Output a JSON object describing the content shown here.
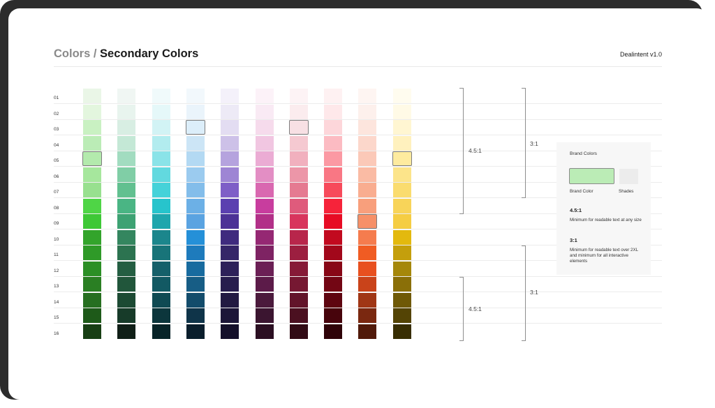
{
  "header": {
    "breadcrumb_parent": "Colors",
    "breadcrumb_separator": " / ",
    "page_title": "Secondary Colors",
    "version": "Dealintent v1.0"
  },
  "rows": [
    "01",
    "02",
    "03",
    "04",
    "05",
    "06",
    "07",
    "08",
    "09",
    "10",
    "11",
    "12",
    "13",
    "14",
    "15",
    "16"
  ],
  "palette": [
    {
      "selected": 4,
      "shades": [
        "#eaf6e7",
        "#e3f6de",
        "#c9f1c2",
        "#bbecb6",
        "#b3eaad",
        "#a6e79d",
        "#98e08f",
        "#4fd546",
        "#3ec836",
        "#33a42b",
        "#2f9a28",
        "#2b8f25",
        "#2a7f23",
        "#266f20",
        "#1e5a19",
        "#183f14"
      ]
    },
    {
      "selected": -1,
      "shades": [
        "#f0f6f3",
        "#e8f4ee",
        "#d8eee3",
        "#c4e8d6",
        "#a2dcc0",
        "#80cea6",
        "#62c090",
        "#4ab584",
        "#3da273",
        "#34865f",
        "#2c7350",
        "#245e42",
        "#21563b",
        "#1c4a33",
        "#173b29",
        "#101f17"
      ]
    },
    {
      "selected": -1,
      "shades": [
        "#f0fafb",
        "#e5f8f9",
        "#d2f3f5",
        "#b2ecef",
        "#8ae3e8",
        "#62d9df",
        "#45d2d9",
        "#27c4cc",
        "#1fa6ad",
        "#1b868c",
        "#187479",
        "#15606a",
        "#125963",
        "#0f4a53",
        "#0c363c",
        "#082428"
      ]
    },
    {
      "selected": 2,
      "shades": [
        "#f2f8fc",
        "#eaf4fb",
        "#dceefa",
        "#cce5f6",
        "#b3d9f3",
        "#9bcbef",
        "#83bdea",
        "#6cb0e6",
        "#5aa3e1",
        "#2590d8",
        "#1e7bbc",
        "#186b9f",
        "#175d85",
        "#134c6b",
        "#0f3449",
        "#0a1e2c"
      ]
    },
    {
      "selected": -1,
      "shades": [
        "#f4f1fa",
        "#edeaf6",
        "#e3ddf2",
        "#cdc1e8",
        "#b5a3de",
        "#9e85d4",
        "#7e5ec7",
        "#5b40b0",
        "#4c3296",
        "#3f2b7e",
        "#352668",
        "#2d2159",
        "#271d4d",
        "#221a42",
        "#1c1638",
        "#14102a"
      ]
    },
    {
      "selected": -1,
      "shades": [
        "#fcf2f8",
        "#f9eaf4",
        "#f6dbec",
        "#f1c6e1",
        "#ebacd4",
        "#e38ec4",
        "#d968b0",
        "#c83d9e",
        "#b23088",
        "#952873",
        "#7e2363",
        "#6b1f55",
        "#5c1b49",
        "#4b1a3c",
        "#3b1530",
        "#2b0f22"
      ]
    },
    {
      "selected": 2,
      "shades": [
        "#fdf3f5",
        "#fbecee",
        "#f8e0e4",
        "#f5c9d1",
        "#f1b0be",
        "#ec96a8",
        "#e57a91",
        "#df5b7c",
        "#d8355d",
        "#b8264b",
        "#9c1f40",
        "#861a37",
        "#761832",
        "#62142a",
        "#4b1020",
        "#320b15"
      ]
    },
    {
      "selected": -1,
      "shades": [
        "#fef1f2",
        "#fee8ea",
        "#fdd6da",
        "#fcbbc2",
        "#fb99a3",
        "#f97784",
        "#f74a5b",
        "#f6233a",
        "#e70b24",
        "#c20a1f",
        "#a2081b",
        "#880716",
        "#730614",
        "#5e0510",
        "#47040c",
        "#2f0308"
      ]
    },
    {
      "selected": 8,
      "shades": [
        "#fef5f2",
        "#fdf0ec",
        "#fde5dd",
        "#fcd7cb",
        "#fbc9b8",
        "#fabba4",
        "#f9ad90",
        "#f89f7c",
        "#f69068",
        "#f57c4e",
        "#f05c23",
        "#e8501f",
        "#c9431a",
        "#a03615",
        "#7a2810",
        "#511a0a"
      ]
    },
    {
      "selected": 4,
      "shades": [
        "#fffcef",
        "#fffae6",
        "#fff6d2",
        "#fff1be",
        "#feeb9f",
        "#fce48a",
        "#fadc6f",
        "#f8d459",
        "#f5cd43",
        "#e3b90e",
        "#c49f0c",
        "#a5870a",
        "#8a6f08",
        "#6f5906",
        "#544405",
        "#382e03"
      ]
    }
  ],
  "ratio_brackets": [
    {
      "label": "4.5:1"
    },
    {
      "label": "3:1"
    },
    {
      "label": "4.5:1"
    },
    {
      "label": "3:1"
    }
  ],
  "legend": {
    "title": "Brand Colors",
    "brand_color_label": "Brand Color",
    "shades_label": "Shades",
    "brand_color_value": "#bbecb6",
    "ratio1": "4.5:1",
    "ratio1_desc": "Minimum for readable text at any size",
    "ratio2": "3:1",
    "ratio2_desc": "Minimum for readable text over 2XL and minimum for all interactive elements"
  }
}
